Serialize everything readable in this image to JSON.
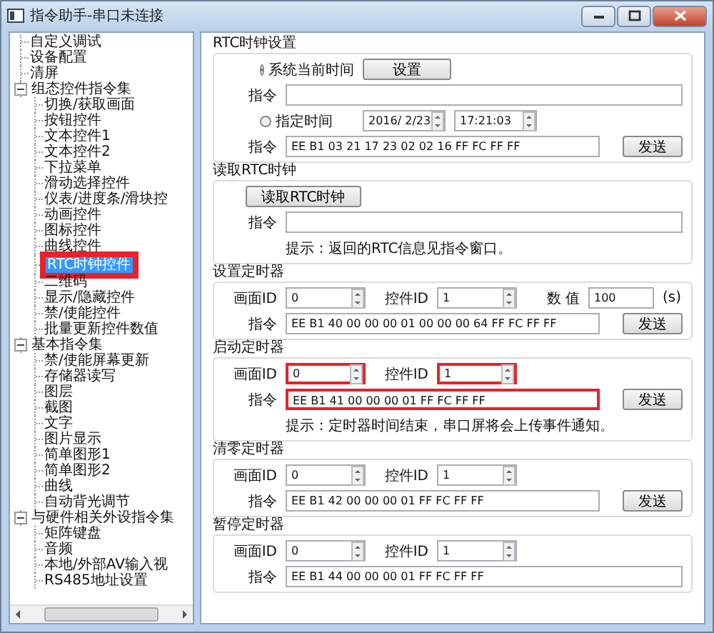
{
  "window": {
    "title": "指令助手-串口未连接"
  },
  "tree": [
    {
      "label": "自定义调试",
      "selected": false,
      "highlighted": false
    },
    {
      "label": "设备配置",
      "selected": false,
      "highlighted": false
    },
    {
      "label": "清屏",
      "selected": false,
      "highlighted": false
    },
    {
      "label": "组态控件指令集",
      "selected": false,
      "highlighted": false,
      "expanded": true,
      "children": [
        {
          "label": "切换/获取画面",
          "selected": false,
          "highlighted": false
        },
        {
          "label": "按钮控件",
          "selected": false,
          "highlighted": false
        },
        {
          "label": "文本控件1",
          "selected": false,
          "highlighted": false
        },
        {
          "label": "文本控件2",
          "selected": false,
          "highlighted": false
        },
        {
          "label": "下拉菜单",
          "selected": false,
          "highlighted": false
        },
        {
          "label": "滑动选择控件",
          "selected": false,
          "highlighted": false
        },
        {
          "label": "仪表/进度条/滑块控",
          "selected": false,
          "highlighted": false
        },
        {
          "label": "动画控件",
          "selected": false,
          "highlighted": false
        },
        {
          "label": "图标控件",
          "selected": false,
          "highlighted": false
        },
        {
          "label": "曲线控件",
          "selected": false,
          "highlighted": false
        },
        {
          "label": "RTC时钟控件",
          "selected": true,
          "highlighted": true
        },
        {
          "label": "二维码",
          "selected": false,
          "highlighted": false
        },
        {
          "label": "显示/隐藏控件",
          "selected": false,
          "highlighted": false
        },
        {
          "label": "禁/使能控件",
          "selected": false,
          "highlighted": false
        },
        {
          "label": "批量更新控件数值",
          "selected": false,
          "highlighted": false
        }
      ]
    },
    {
      "label": "基本指令集",
      "selected": false,
      "highlighted": false,
      "expanded": true,
      "children": [
        {
          "label": "禁/使能屏幕更新",
          "selected": false,
          "highlighted": false
        },
        {
          "label": "存储器读写",
          "selected": false,
          "highlighted": false
        },
        {
          "label": "图层",
          "selected": false,
          "highlighted": false
        },
        {
          "label": "截图",
          "selected": false,
          "highlighted": false
        },
        {
          "label": "文字",
          "selected": false,
          "highlighted": false
        },
        {
          "label": "图片显示",
          "selected": false,
          "highlighted": false
        },
        {
          "label": "简单图形1",
          "selected": false,
          "highlighted": false
        },
        {
          "label": "简单图形2",
          "selected": false,
          "highlighted": false
        },
        {
          "label": "曲线",
          "selected": false,
          "highlighted": false
        },
        {
          "label": "自动背光调节",
          "selected": false,
          "highlighted": false
        }
      ]
    },
    {
      "label": "与硬件相关外设指令集",
      "selected": false,
      "highlighted": false,
      "expanded": true,
      "children": [
        {
          "label": "矩阵键盘",
          "selected": false,
          "highlighted": false
        },
        {
          "label": "音频",
          "selected": false,
          "highlighted": false
        },
        {
          "label": "本地/外部AV输入视",
          "selected": false,
          "highlighted": false
        },
        {
          "label": "RS485地址设置",
          "selected": false,
          "highlighted": false
        }
      ]
    }
  ],
  "sections": [
    {
      "title": "RTC时钟设置",
      "lines": [
        {
          "controls": [
            {
              "kind": "radio",
              "label": "系统当前时间",
              "selected": true
            },
            {
              "kind": "button",
              "label": "设置"
            }
          ]
        },
        {
          "controls": [
            {
              "kind": "label",
              "text": "指令"
            },
            {
              "kind": "field",
              "highlighted": false
            }
          ]
        },
        {
          "controls": [
            {
              "kind": "radio",
              "label": "指定时间",
              "selected": false
            },
            {
              "kind": "datespin",
              "value": "2016/ 2/23",
              "highlighted": false
            },
            {
              "kind": "datespin",
              "value": "17:21:03",
              "highlighted": false
            }
          ]
        },
        {
          "controls": [
            {
              "kind": "label",
              "text": "指令"
            },
            {
              "kind": "field",
              "value": "EE B1 03 21 17 23 02 02 16 FF FC FF FF",
              "highlighted": false
            },
            {
              "kind": "button",
              "label": "发送"
            }
          ]
        }
      ]
    },
    {
      "title": "读取RTC时钟",
      "lines": [
        {
          "controls": [
            {
              "kind": "button",
              "label": "读取RTC时钟"
            }
          ]
        },
        {
          "controls": [
            {
              "kind": "label",
              "text": "指令"
            },
            {
              "kind": "field",
              "highlighted": false
            }
          ]
        },
        {
          "controls": [
            {
              "kind": "hint",
              "text": "提示：返回的RTC信息见指令窗口。"
            }
          ]
        }
      ]
    },
    {
      "title": "设置定时器",
      "lines": [
        {
          "controls": [
            {
              "kind": "label",
              "text": "画面ID"
            },
            {
              "kind": "spin",
              "value": "0",
              "highlighted": false
            },
            {
              "kind": "label",
              "text": "控件ID"
            },
            {
              "kind": "spin",
              "value": "1",
              "highlighted": false
            },
            {
              "kind": "label",
              "text": "数 值"
            },
            {
              "kind": "shortfield",
              "value": "100",
              "highlighted": false
            },
            {
              "kind": "unit",
              "text": "(s)"
            }
          ]
        },
        {
          "controls": [
            {
              "kind": "label",
              "text": "指令"
            },
            {
              "kind": "field",
              "value": "EE B1 40 00 00 00 01 00 00 00 64 FF FC FF FF",
              "highlighted": false
            },
            {
              "kind": "button",
              "label": "发送"
            }
          ]
        }
      ]
    },
    {
      "title": "启动定时器",
      "lines": [
        {
          "controls": [
            {
              "kind": "label",
              "text": "画面ID"
            },
            {
              "kind": "spin",
              "value": "0",
              "highlighted": true
            },
            {
              "kind": "label",
              "text": "控件ID"
            },
            {
              "kind": "spin",
              "value": "1",
              "highlighted": true
            }
          ]
        },
        {
          "controls": [
            {
              "kind": "label",
              "text": "指令"
            },
            {
              "kind": "field",
              "value": "EE B1 41 00 00 00 01 FF FC FF FF",
              "highlighted": true
            },
            {
              "kind": "button",
              "label": "发送"
            }
          ]
        },
        {
          "controls": [
            {
              "kind": "hint",
              "text": "提示：定时器时间结束，串口屏将会上传事件通知。"
            }
          ]
        }
      ]
    },
    {
      "title": "清零定时器",
      "lines": [
        {
          "controls": [
            {
              "kind": "label",
              "text": "画面ID"
            },
            {
              "kind": "spin",
              "value": "0",
              "highlighted": false
            },
            {
              "kind": "label",
              "text": "控件ID"
            },
            {
              "kind": "spin",
              "value": "1",
              "highlighted": false
            }
          ]
        },
        {
          "controls": [
            {
              "kind": "label",
              "text": "指令"
            },
            {
              "kind": "field",
              "value": "EE B1 42 00 00 00 01 FF FC FF FF",
              "highlighted": false
            },
            {
              "kind": "button",
              "label": "发送"
            }
          ]
        }
      ]
    },
    {
      "title": "暂停定时器",
      "lines": [
        {
          "controls": [
            {
              "kind": "label",
              "text": "画面ID"
            },
            {
              "kind": "spin",
              "value": "0",
              "highlighted": false
            },
            {
              "kind": "label",
              "text": "控件ID"
            },
            {
              "kind": "spin",
              "value": "1",
              "highlighted": false
            }
          ]
        },
        {
          "controls": [
            {
              "kind": "label",
              "text": "指令"
            },
            {
              "kind": "field",
              "value": "EE B1 44 00 00 00 01 FF FC FF FF",
              "highlighted": false
            }
          ]
        }
      ]
    }
  ]
}
